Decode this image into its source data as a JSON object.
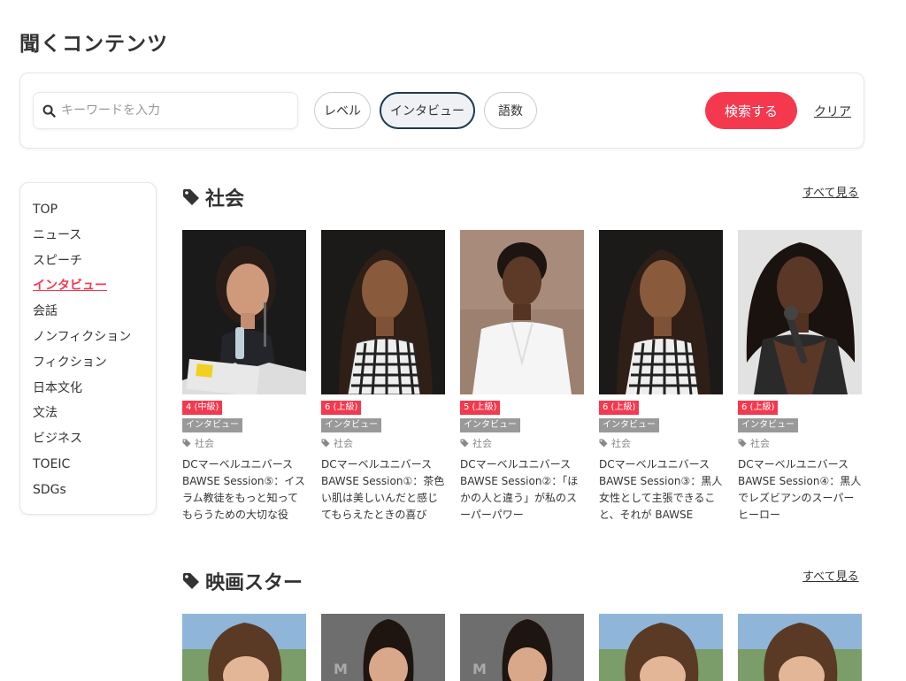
{
  "page": {
    "title": "聞くコンテンツ"
  },
  "search": {
    "placeholder": "キーワードを入力",
    "filters": {
      "level": "レベル",
      "genre": "インタビュー",
      "words": "語数"
    },
    "submit_label": "検索する",
    "clear_label": "クリア"
  },
  "sidebar": {
    "items": [
      {
        "label": "TOP"
      },
      {
        "label": "ニュース"
      },
      {
        "label": "スピーチ"
      },
      {
        "label": "インタビュー",
        "active": true
      },
      {
        "label": "会話"
      },
      {
        "label": "ノンフィクション"
      },
      {
        "label": "フィクション"
      },
      {
        "label": "日本文化"
      },
      {
        "label": "文法"
      },
      {
        "label": "ビジネス"
      },
      {
        "label": "TOEIC"
      },
      {
        "label": "SDGs"
      }
    ]
  },
  "sections": [
    {
      "title": "社会",
      "see_all": "すべて見る",
      "cards": [
        {
          "level": "4 (中級)",
          "genre": "インタビュー",
          "tag": "社会",
          "text": "DCマーベルユニバース BAWSE Session⑤：イスラム教徒をもっと知ってもらうための大切な役"
        },
        {
          "level": "6 (上級)",
          "genre": "インタビュー",
          "tag": "社会",
          "text": "DCマーベルユニバース BAWSE Session①：茶色い肌は美しいんだと感じてもらえたときの喜び"
        },
        {
          "level": "5 (上級)",
          "genre": "インタビュー",
          "tag": "社会",
          "text": "DCマーベルユニバース BAWSE Session②：「ほかの人と違う」が私のスーパーパワー"
        },
        {
          "level": "6 (上級)",
          "genre": "インタビュー",
          "tag": "社会",
          "text": "DCマーベルユニバース BAWSE Session③：黒人女性として主張できること、それが BAWSE"
        },
        {
          "level": "6 (上級)",
          "genre": "インタビュー",
          "tag": "社会",
          "text": "DCマーベルユニバース BAWSE Session④：黒人でレズビアンのスーパーヒーロー"
        }
      ]
    },
    {
      "title": "映画スター",
      "see_all": "すべて見る"
    }
  ],
  "colors": {
    "accent": "#f4394f",
    "genre_badge": "#999999",
    "active_pill_border": "#1f3a4d"
  },
  "icons": {
    "search": "search-icon",
    "tag": "tag-icon"
  }
}
